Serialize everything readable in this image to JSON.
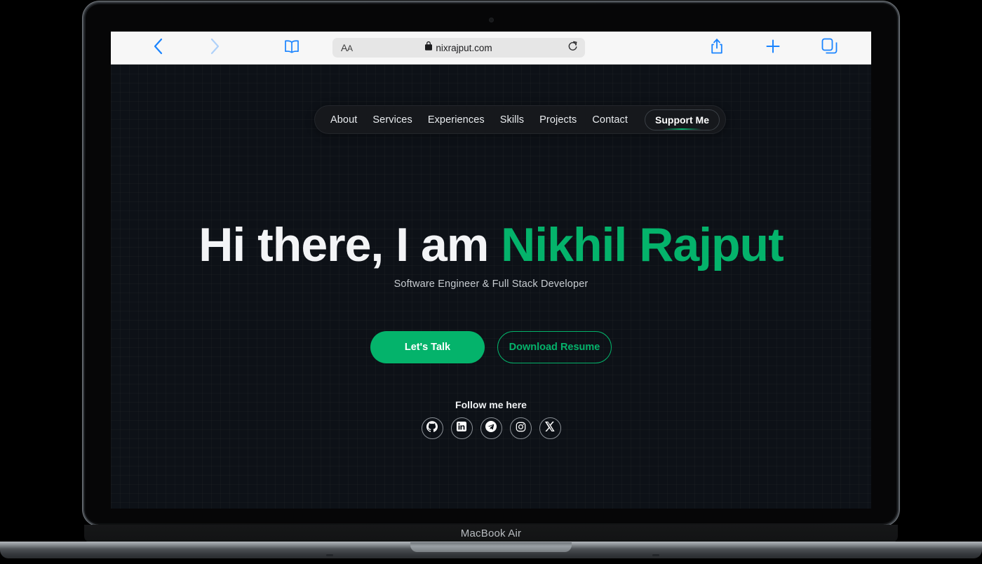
{
  "device": {
    "model_label": "MacBook Air",
    "camera_icon": "camera-dot"
  },
  "browser": {
    "name": "Safari",
    "toolbar": {
      "back_icon": "chevron-left-icon",
      "forward_icon": "chevron-right-icon",
      "reader_icon": "book-icon",
      "text_size_label": "AA",
      "lock_icon": "lock-icon",
      "url": "nixrajput.com",
      "reload_icon": "reload-icon",
      "share_icon": "share-icon",
      "new_tab_icon": "plus-icon",
      "tabs_icon": "tabs-icon"
    }
  },
  "site": {
    "nav": {
      "items": [
        {
          "label": "About"
        },
        {
          "label": "Services"
        },
        {
          "label": "Experiences"
        },
        {
          "label": "Skills"
        },
        {
          "label": "Projects"
        },
        {
          "label": "Contact"
        }
      ],
      "cta_label": "Support Me"
    },
    "hero": {
      "greeting": "Hi there, I am ",
      "name": "Nikhil Rajput",
      "subtitle": "Software Engineer & Full Stack Developer",
      "primary_button": "Let's Talk",
      "secondary_button": "Download Resume"
    },
    "social": {
      "heading": "Follow me here",
      "items": [
        {
          "name": "github-icon"
        },
        {
          "name": "linkedin-icon"
        },
        {
          "name": "telegram-icon"
        },
        {
          "name": "instagram-icon"
        },
        {
          "name": "x-twitter-icon"
        }
      ]
    },
    "colors": {
      "accent_green": "#04b36b",
      "page_background": "#0d1117",
      "nav_background": "#16181c",
      "heading_text": "#f3f4f6"
    }
  }
}
